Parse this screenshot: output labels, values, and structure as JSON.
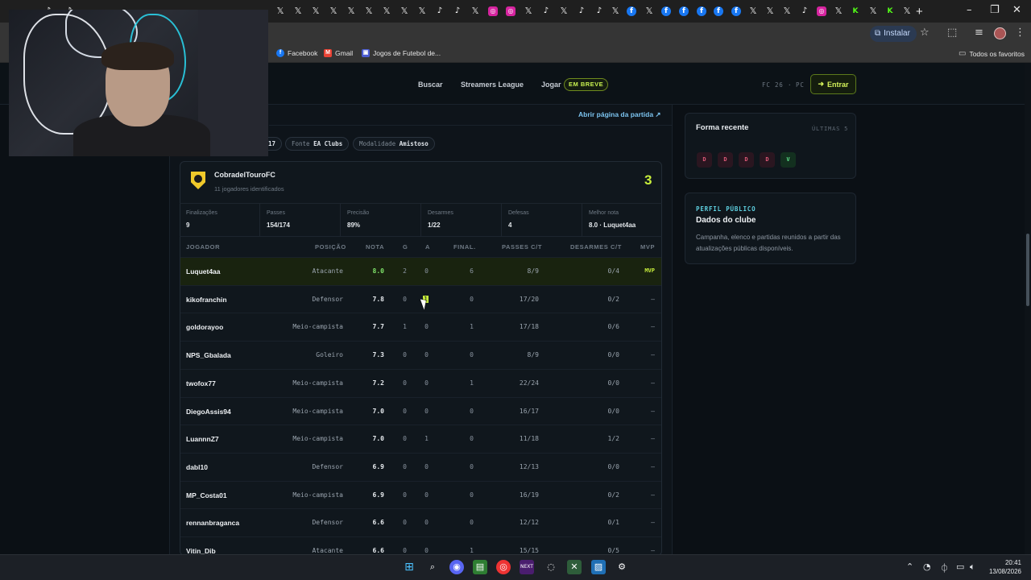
{
  "browser": {
    "install_label": "Instalar",
    "bookmarks": [
      "Facebook",
      "Gmail",
      "Jogos de Futebol de..."
    ],
    "all_bookmarks_label": "Todos os favoritos"
  },
  "nav": {
    "links": [
      "Buscar",
      "Streamers League",
      "Jogar"
    ],
    "soon_badge": "EM BREVE",
    "platform_game": "FC 26",
    "platform_sep": "·",
    "platform_device": "PC",
    "enter_label": "Entrar"
  },
  "match": {
    "open_link": "Abrir página da partida ↗",
    "date_fragment": "17",
    "source_label": "Fonte",
    "source_value": "EA Clubs",
    "mode_label": "Modalidade",
    "mode_value": "Amistoso"
  },
  "team": {
    "name": "CobradelTouroFC",
    "subtitle": "11 jogadores identificados",
    "score": "3",
    "stats": [
      {
        "label": "Finalizações",
        "value": "9"
      },
      {
        "label": "Passes",
        "value": "154/174"
      },
      {
        "label": "Precisão",
        "value": "89%"
      },
      {
        "label": "Desarmes",
        "value": "1/22"
      },
      {
        "label": "Defesas",
        "value": "4"
      },
      {
        "label": "Melhor nota",
        "value": "8.0 · Luquet4aa"
      }
    ]
  },
  "table": {
    "headers": {
      "player": "JOGADOR",
      "position": "POSIÇÃO",
      "rating": "NOTA",
      "goals": "G",
      "assists": "A",
      "shots": "FINAL.",
      "passes": "PASSES C/T",
      "tackles": "DESARMES C/T",
      "mvp": "MVP"
    },
    "rows": [
      {
        "name": "Luquet4aa",
        "pos": "Atacante",
        "nota": "8.0",
        "g": "2",
        "a": "0",
        "fin": "6",
        "pass": "8/9",
        "des": "0/4",
        "mvp": "MVP"
      },
      {
        "name": "kikofranchin",
        "pos": "Defensor",
        "nota": "7.8",
        "g": "0",
        "a": "1",
        "fin": "0",
        "pass": "17/20",
        "des": "0/2",
        "mvp": "—"
      },
      {
        "name": "goldorayoo",
        "pos": "Meio-campista",
        "nota": "7.7",
        "g": "1",
        "a": "0",
        "fin": "1",
        "pass": "17/18",
        "des": "0/6",
        "mvp": "—"
      },
      {
        "name": "NPS_Gbalada",
        "pos": "Goleiro",
        "nota": "7.3",
        "g": "0",
        "a": "0",
        "fin": "0",
        "pass": "8/9",
        "des": "0/0",
        "mvp": "—"
      },
      {
        "name": "twofox77",
        "pos": "Meio-campista",
        "nota": "7.2",
        "g": "0",
        "a": "0",
        "fin": "1",
        "pass": "22/24",
        "des": "0/0",
        "mvp": "—"
      },
      {
        "name": "DiegoAssis94",
        "pos": "Meio-campista",
        "nota": "7.0",
        "g": "0",
        "a": "0",
        "fin": "0",
        "pass": "16/17",
        "des": "0/0",
        "mvp": "—"
      },
      {
        "name": "LuannnZ7",
        "pos": "Meio-campista",
        "nota": "7.0",
        "g": "0",
        "a": "1",
        "fin": "0",
        "pass": "11/18",
        "des": "1/2",
        "mvp": "—"
      },
      {
        "name": "dabl10",
        "pos": "Defensor",
        "nota": "6.9",
        "g": "0",
        "a": "0",
        "fin": "0",
        "pass": "12/13",
        "des": "0/0",
        "mvp": "—"
      },
      {
        "name": "MP_Costa01",
        "pos": "Meio-campista",
        "nota": "6.9",
        "g": "0",
        "a": "0",
        "fin": "0",
        "pass": "16/19",
        "des": "0/2",
        "mvp": "—"
      },
      {
        "name": "rennanbraganca",
        "pos": "Defensor",
        "nota": "6.6",
        "g": "0",
        "a": "0",
        "fin": "0",
        "pass": "12/12",
        "des": "0/1",
        "mvp": "—"
      },
      {
        "name": "Vitin_Dib",
        "pos": "Atacante",
        "nota": "6.6",
        "g": "0",
        "a": "0",
        "fin": "1",
        "pass": "15/15",
        "des": "0/5",
        "mvp": "—"
      }
    ]
  },
  "form": {
    "title": "Forma recente",
    "subtitle": "ÚLTIMAS 5",
    "results": [
      "D",
      "D",
      "D",
      "D",
      "V"
    ]
  },
  "profile": {
    "kicker": "PERFIL PÚBLICO",
    "title": "Dados do clube",
    "text": "Campanha, elenco e partidas reunidos a partir das atualizações públicas disponíveis."
  },
  "clock": {
    "time": "20:41",
    "date": "13/08/2026"
  },
  "colors": {
    "accent": "#c8ef3c",
    "background": "#0b1015",
    "link": "#7cc4f0",
    "loss": "#e05a78",
    "win": "#5ee08a"
  }
}
